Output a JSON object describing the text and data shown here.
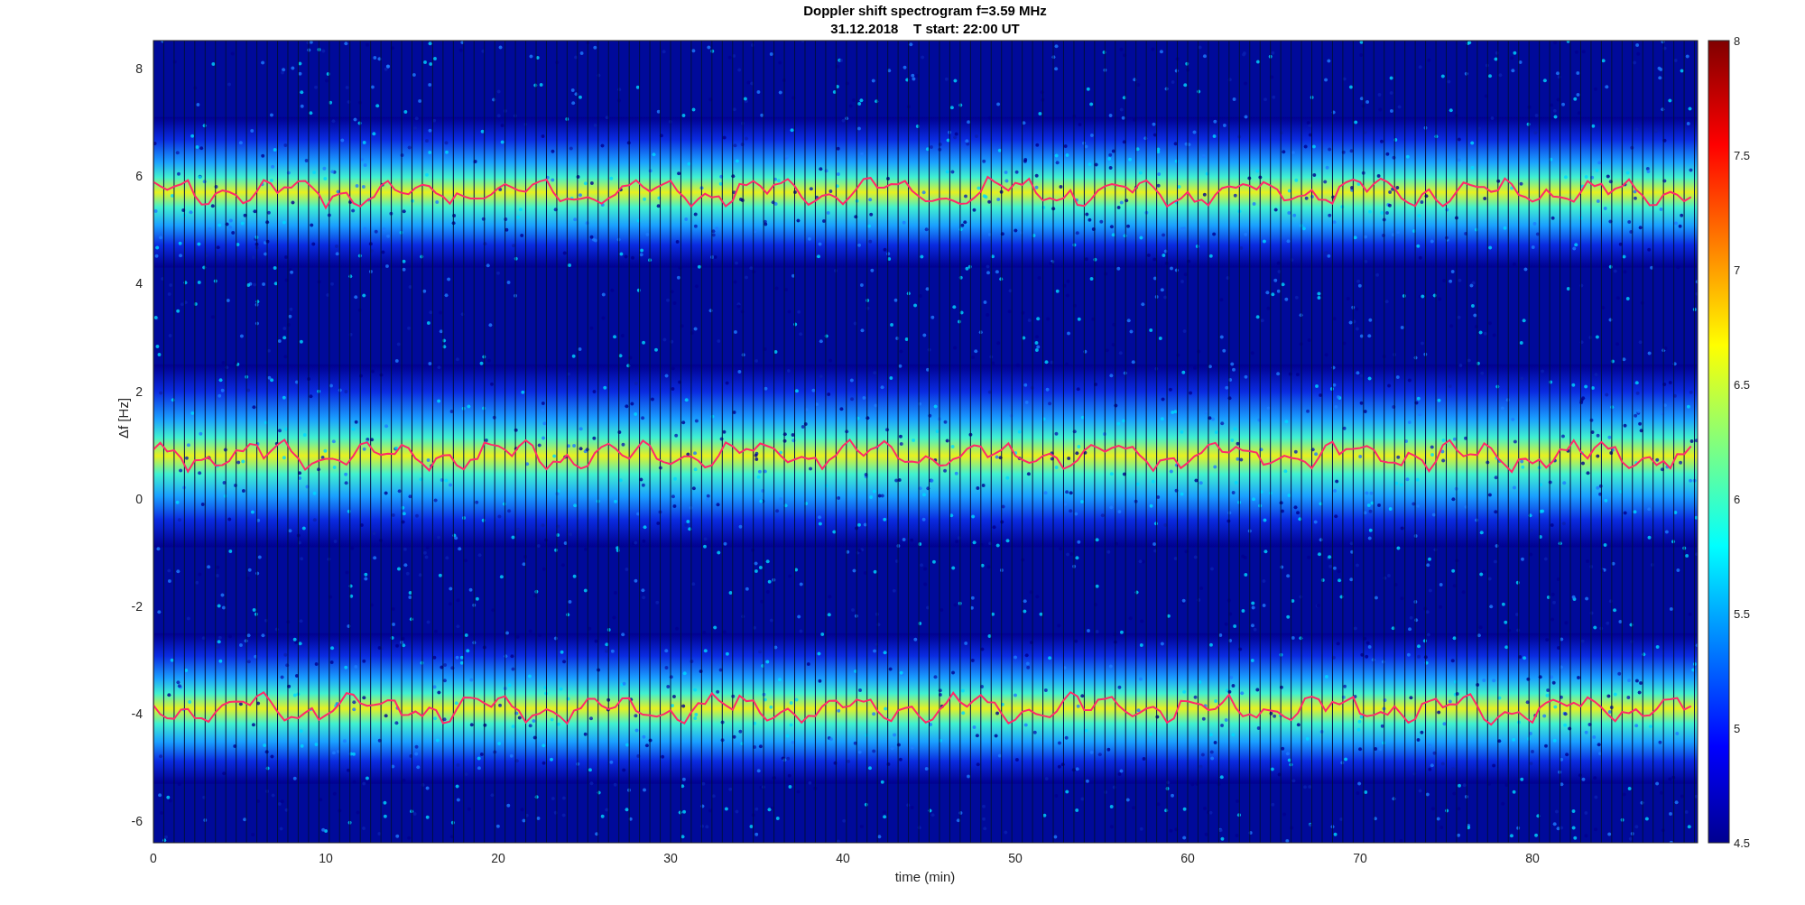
{
  "title": [
    "Doppler shift spectrogram f=3.59 MHz",
    "31.12.2018    T start: 22:00 UT"
  ],
  "ylabel": "Δf [Hz]",
  "xlabel": "time (min)",
  "xticks": [
    "0",
    "10",
    "20",
    "30",
    "40",
    "50",
    "60",
    "70",
    "80"
  ],
  "yticks": [
    "8",
    "6",
    "4",
    "2",
    "0",
    "-2",
    "-4",
    "-6"
  ],
  "colorbar_ticks": [
    "8",
    "7.5",
    "7",
    "6.5",
    "6",
    "5.5",
    "5",
    "4.5"
  ]
}
